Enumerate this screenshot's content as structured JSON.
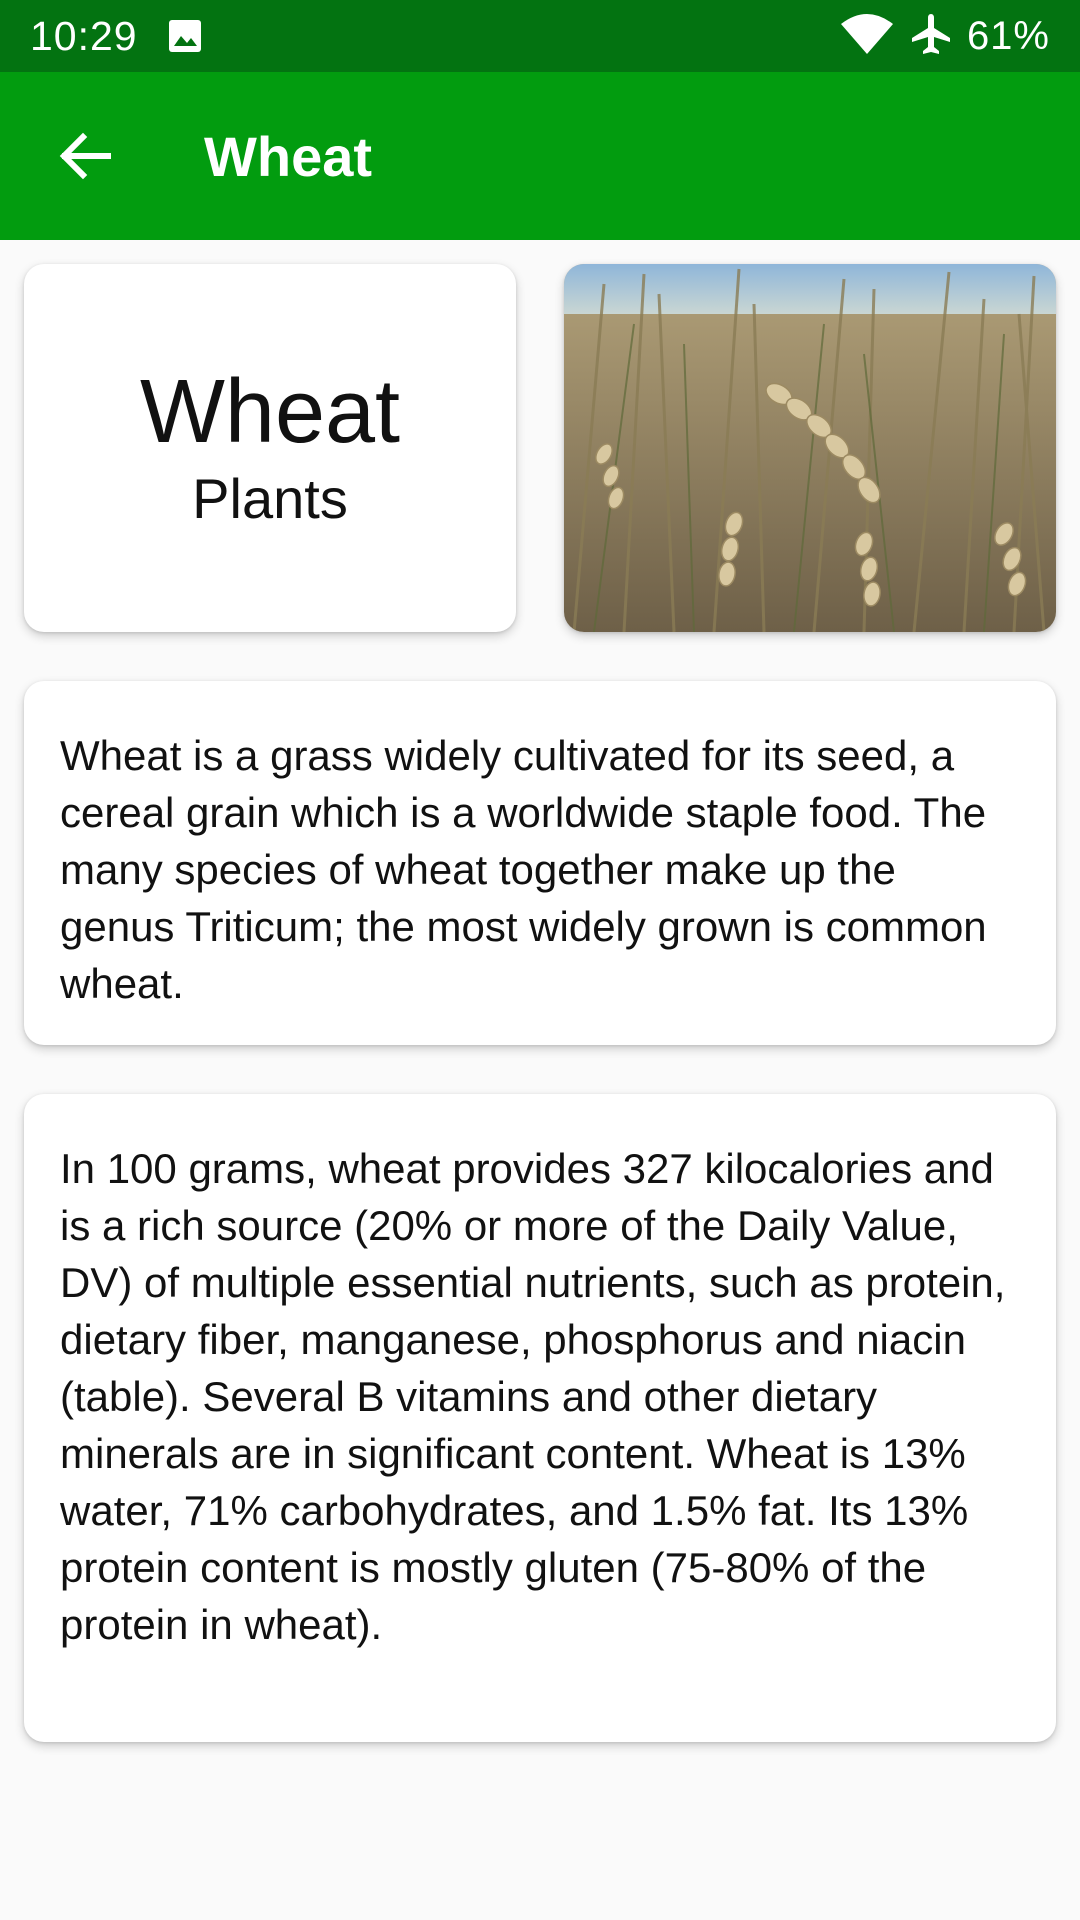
{
  "status_bar": {
    "time": "10:29",
    "battery": "61%",
    "icons": [
      "image-icon",
      "wifi-icon",
      "airplane-icon"
    ]
  },
  "app_bar": {
    "title": "Wheat",
    "back_icon": "arrow-back-icon"
  },
  "header_card": {
    "name": "Wheat",
    "category": "Plants"
  },
  "photo": {
    "subject": "wheat field"
  },
  "description": "Wheat is a grass widely cultivated for its seed, a cereal grain which is a worldwide staple food. The many species of wheat together make up the genus Triticum; the most widely grown is common wheat.",
  "nutrition": "In 100 grams, wheat provides 327 kilocalories and is a rich source (20% or more of the Daily Value, DV) of multiple essential nutrients, such as protein, dietary fiber, manganese, phosphorus and niacin (table). Several B vitamins and other dietary minerals are in significant content. Wheat is 13% water, 71% carbohydrates, and 1.5% fat. Its 13% protein content is mostly gluten (75-80% of the protein in wheat).",
  "colors": {
    "status_bar": "#037311",
    "app_bar": "#029c0f",
    "background": "#fafafa"
  }
}
